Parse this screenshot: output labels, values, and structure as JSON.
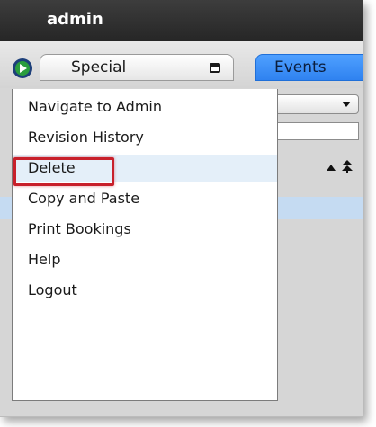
{
  "window": {
    "title": "admin"
  },
  "toolbar": {
    "special_label": "Special",
    "events_label": "Events"
  },
  "menu": {
    "items": [
      {
        "label": "Navigate to Admin"
      },
      {
        "label": "Revision History"
      },
      {
        "label": "Delete"
      },
      {
        "label": "Copy and Paste"
      },
      {
        "label": "Print Bookings"
      },
      {
        "label": "Help"
      },
      {
        "label": "Logout"
      }
    ],
    "highlighted_item": "Delete"
  },
  "colors": {
    "titlebar": "#2e2e2e",
    "events_tab": "#3a8cf5",
    "selected_row": "#c5dbf2",
    "highlight_outline": "#c8202b"
  },
  "icons": {
    "app_logo": "app-logo-icon",
    "special_button": "window-icon",
    "select": "chevron-down-icon",
    "sort_up": "sort-up-icon",
    "sort_top": "sort-top-icon"
  }
}
